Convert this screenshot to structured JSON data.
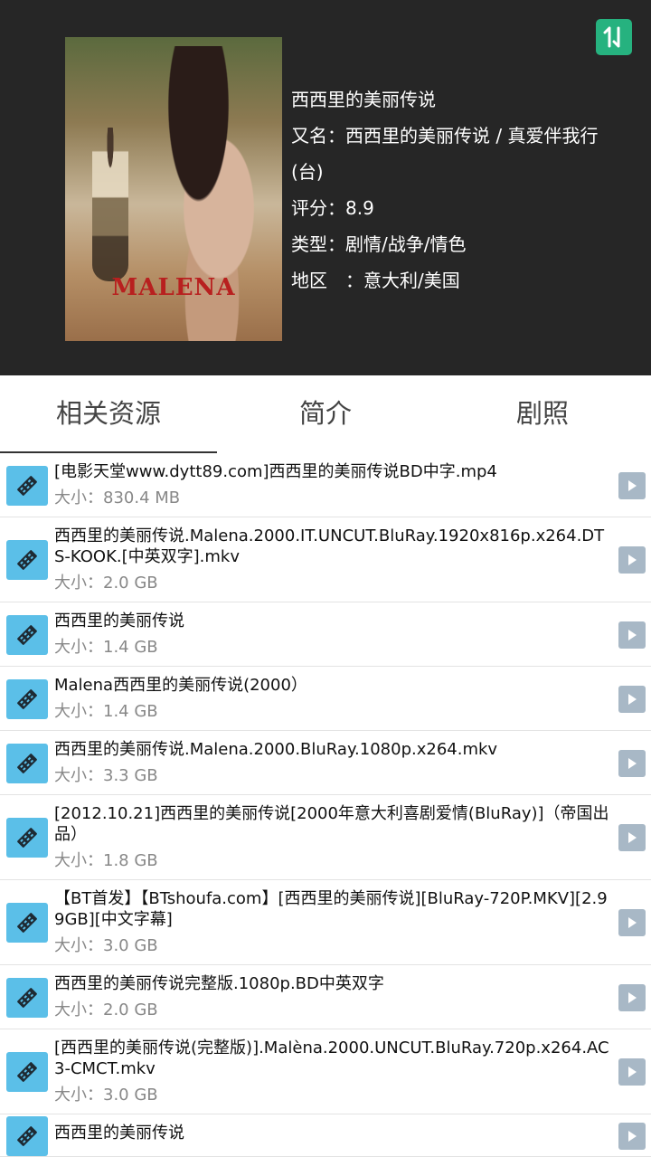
{
  "movie": {
    "title": "西西里的美丽传说",
    "alias_line1": "又名：西西里的美丽传说 / 真爱伴我行",
    "alias_line2": "(台)",
    "rating": "评分：8.9",
    "genre": "类型：剧情/战争/情色",
    "region": "地区　：意大利/美国",
    "poster_title": "MALENA"
  },
  "tabs": [
    {
      "label": "相关资源"
    },
    {
      "label": "简介"
    },
    {
      "label": "剧照"
    }
  ],
  "resources": [
    {
      "title": "[电影天堂www.dytt89.com]西西里的美丽传说BD中字.mp4",
      "size": "大小：830.4 MB"
    },
    {
      "title": "西西里的美丽传说.Malena.2000.IT.UNCUT.BluRay.1920x816p.x264.DTS-KOOK.[中英双字].mkv",
      "size": "大小：2.0 GB"
    },
    {
      "title": "西西里的美丽传说",
      "size": "大小：1.4 GB"
    },
    {
      "title": "Malena西西里的美丽传说(2000）",
      "size": "大小：1.4 GB"
    },
    {
      "title": "西西里的美丽传说.Malena.2000.BluRay.1080p.x264.mkv",
      "size": "大小：3.3 GB"
    },
    {
      "title": "[2012.10.21]西西里的美丽传说[2000年意大利喜剧爱情(BluRay)]（帝国出品）",
      "size": "大小：1.8 GB"
    },
    {
      "title": "【BT首发】【BTshoufa.com】[西西里的美丽传说][BluRay-720P.MKV][2.99GB][中文字幕]",
      "size": "大小：3.0 GB"
    },
    {
      "title": "西西里的美丽传说完整版.1080p.BD中英双字",
      "size": "大小：2.0 GB"
    },
    {
      "title": "[西西里的美丽传说(完整版)].Malèna.2000.UNCUT.BluRay.720p.x264.AC3-CMCT.mkv",
      "size": "大小：3.0 GB"
    },
    {
      "title": "西西里的美丽传说",
      "size": ""
    }
  ],
  "colors": {
    "header_bg": "#262626",
    "accent_green": "#26b27f",
    "file_icon_bg": "#5bbfe8",
    "play_icon_bg": "#a8b8c6"
  },
  "icons": {
    "sort": "sort-arrows-icon",
    "file": "film-strip-icon",
    "play": "play-icon"
  }
}
